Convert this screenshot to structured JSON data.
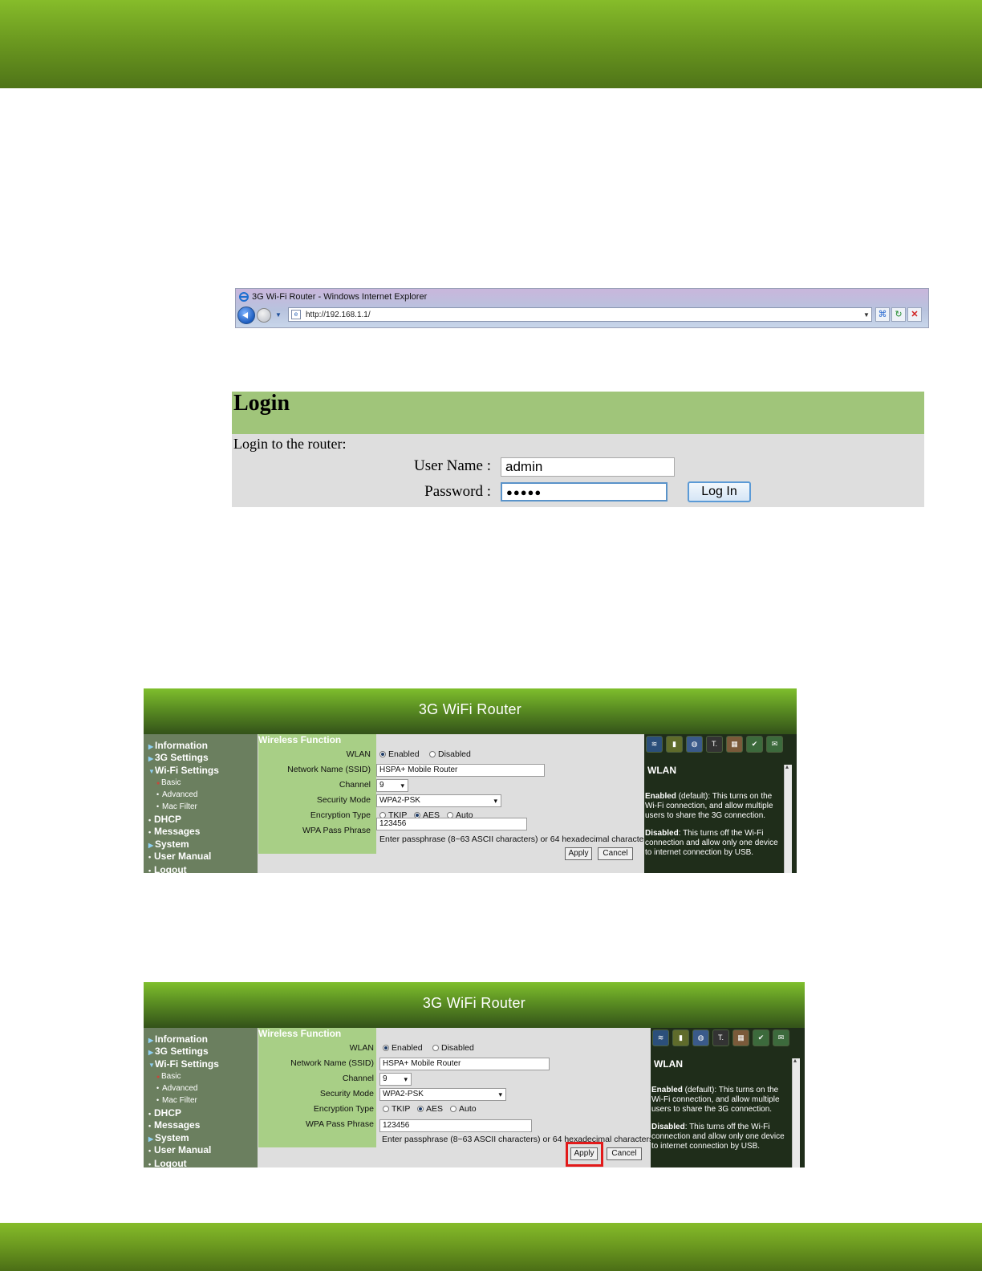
{
  "ie": {
    "title": "3G Wi-Fi Router - Windows Internet Explorer",
    "url": "http://192.168.1.1/"
  },
  "login": {
    "title": "Login",
    "subtitle": "Login to the router:",
    "user_label": "User Name :",
    "user_value": "admin",
    "pass_label": "Password :",
    "pass_value": "●●●●●",
    "button": "Log In"
  },
  "router": {
    "title": "3G WiFi Router",
    "nav": {
      "information": "Information",
      "g3_settings": "3G Settings",
      "wifi_settings": "Wi-Fi Settings",
      "basic": "Basic",
      "advanced": "Advanced",
      "mac_filter": "Mac Filter",
      "dhcp": "DHCP",
      "messages": "Messages",
      "system": "System",
      "user_manual": "User Manual",
      "logout_partial": "Logout"
    },
    "form": {
      "section": "Wireless Function",
      "wlan_label": "WLAN",
      "wlan_enabled": "Enabled",
      "wlan_disabled": "Disabled",
      "ssid_label": "Network Name (SSID)",
      "ssid_value": "HSPA+ Mobile Router",
      "channel_label": "Channel",
      "channel_value": "9",
      "security_label": "Security Mode",
      "security_value": "WPA2-PSK",
      "enc_label": "Encryption Type",
      "enc_tkip": "TKIP",
      "enc_aes": "AES",
      "enc_auto": "Auto",
      "wpa_label": "WPA Pass Phrase",
      "wpa_value": "123456",
      "hint": "Enter passphrase (8~63 ASCII characters) or 64 hexadecimal characters",
      "apply": "Apply",
      "cancel": "Cancel"
    },
    "help": {
      "title": "WLAN",
      "enabled_term": "Enabled",
      "enabled_text": " (default): This turns on the Wi-Fi connection, and allow multiple users to share the 3G connection.",
      "disabled_term": "Disabled",
      "disabled_text": ": This turns off the Wi-Fi connection and allow only one device to internet connection by USB."
    },
    "status_icons": [
      "wifi-signal-icon",
      "battery-icon",
      "globe-2g-icon",
      "signal-strength-icon",
      "sim-icon",
      "sms-check-icon",
      "connected-icon"
    ]
  },
  "colors": {
    "band_green": "#6c9a20",
    "login_header": "#a0c57a",
    "sidebar": "#6b7f5f",
    "form_label_bg": "#a8cf86",
    "help_bg": "#1f2d1a",
    "highlight": "#e21a1a"
  }
}
